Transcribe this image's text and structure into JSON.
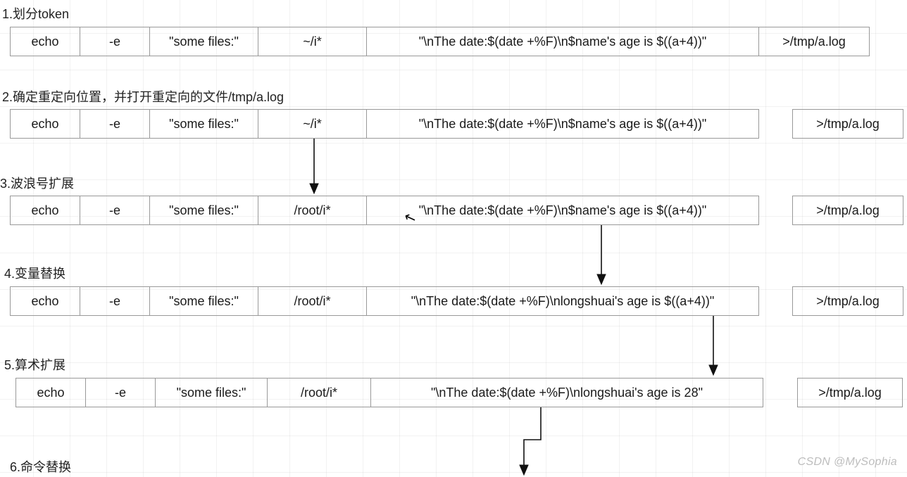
{
  "steps": {
    "s1": {
      "label": "1.划分token"
    },
    "s2": {
      "label": "2.确定重定向位置，并打开重定向的文件/tmp/a.log"
    },
    "s3": {
      "label": "3.波浪号扩展"
    },
    "s4": {
      "label": "4.变量替换"
    },
    "s5": {
      "label": "5.算术扩展"
    },
    "s6": {
      "label": "6.命令替换"
    }
  },
  "tokens": {
    "echo": "echo",
    "dash_e": "-e",
    "somefiles": "\"some files:\"",
    "tilde_i": "~/i*",
    "root_i": "/root/i*",
    "long1": "\"\\nThe date:$(date +%F)\\n$name's age is $((a+4))\"",
    "long2": "\"\\nThe date:$(date +%F)\\nlongshuai's age is $((a+4))\"",
    "long3": "\"\\nThe date:$(date +%F)\\nlongshuai's age is 28\"",
    "redir": ">/tmp/a.log"
  },
  "watermark": "CSDN @MySophia"
}
